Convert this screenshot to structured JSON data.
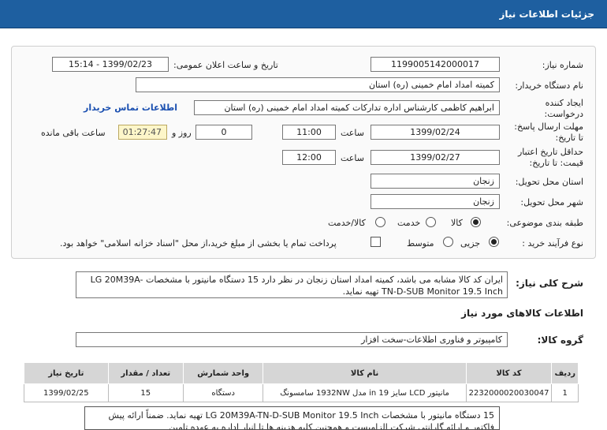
{
  "header": {
    "title": "جزئیات اطلاعات نیاز"
  },
  "form": {
    "need_number_label": "شماره نیاز:",
    "need_number": "1199005142000017",
    "announce_label": "تاریخ و ساعت اعلان عمومی:",
    "announce_value": "1399/02/23 - 15:14",
    "buyer_org_label": "نام دستگاه خریدار:",
    "buyer_org": "کمیته امداد امام خمینی (ره) استان",
    "creator_label": "ایجاد کننده درخواست:",
    "creator": "ابراهیم  کاظمی  کارشناس اداره تدارکات   کمیته امداد امام خمینی (ره) استان",
    "contact_link": "اطلاعات تماس خریدار",
    "deadline_label": "مهلت ارسال پاسخ: تا تاریخ:",
    "deadline_date": "1399/02/24",
    "time_label": "ساعت",
    "deadline_time": "11:00",
    "days_value": "0",
    "days_label": "روز و",
    "remaining_time": "01:27:47",
    "remaining_label": "ساعت باقی مانده",
    "validity_label": "حداقل تاریخ اعتبار قیمت: تا تاریخ:",
    "validity_date": "1399/02/27",
    "validity_time_label": "ساعت",
    "validity_time": "12:00",
    "province_label": "استان محل تحویل:",
    "province": "زنجان",
    "city_label": "شهر محل تحویل:",
    "city": "زنجان",
    "category_label": "طبقه بندی موضوعی:",
    "category_options": [
      "کالا",
      "خدمت",
      "کالا/خدمت"
    ],
    "purchase_type_label": "نوع فرآیند خرید :",
    "purchase_options": [
      "جزیی",
      "متوسط"
    ],
    "payment_note": "پرداخت تمام یا بخشی از مبلغ خرید،از محل \"اسناد خزانه اسلامی\" خواهد بود."
  },
  "description": {
    "label": "شرح کلی نیاز:",
    "text": "ایران کد کالا مشابه می باشد، کمیته امداد استان زنجان در نظر دارد 15 دستگاه مانیتور با مشخصات LG 20M39A-TN-D-SUB Monitor 19.5 Inch تهیه نماید."
  },
  "goods": {
    "section_label": "اطلاعات کالاهای مورد نیاز",
    "group_label": "گروه کالا:",
    "group_value": "کامپیوتر و فناوری اطلاعات-سخت افزار",
    "columns": [
      "ردیف",
      "کد کالا",
      "نام کالا",
      "واحد شمارش",
      "تعداد / مقدار",
      "تاریخ نیاز"
    ],
    "rows": [
      [
        "1",
        "2232000020030047",
        "مانیتور LCD سایز 19 in مدل 1932NW سامسونگ",
        "دستگاه",
        "15",
        "1399/02/25"
      ]
    ]
  },
  "bottom_note": "15 دستگاه مانیتور با مشخصات LG 20M39A-TN-D-SUB Monitor 19.5 Inch تهیه نماید. ضمناً ارائه پیش فاکتور و ارائه گارانتی شرکت الزامیست و همچنین کلیه هزینه ها تا انبار اداره به عهده تامین"
}
